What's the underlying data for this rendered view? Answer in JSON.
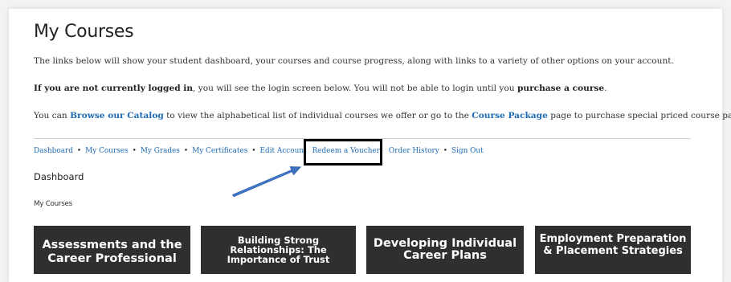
{
  "page": {
    "title": "My Courses"
  },
  "intro": {
    "line1": "The links below will show your student dashboard, your courses and course progress, along with links to a variety of other options on your account.",
    "line2_bold": "If you are not currently logged in",
    "line2_rest": ", you will see the login screen below. You will not be able to login until you ",
    "line2_bold2": "purchase a course",
    "line2_end": ".",
    "line3_a": "You can ",
    "line3_link1": "Browse our Catalog",
    "line3_b": " to view the alphabetical list of individual courses we offer or go to the ",
    "line3_link2": "Course Package",
    "line3_c": " page to purchase special priced course packages."
  },
  "account_nav": {
    "separator": "•",
    "items": [
      "Dashboard",
      "My Courses",
      "My Grades",
      "My Certificates",
      "Edit Account",
      "Redeem a Voucher",
      "Order History",
      "Sign Out"
    ]
  },
  "dashboard": {
    "heading": "Dashboard",
    "subheading": "My Courses"
  },
  "courses": [
    {
      "title": "Assessments and the Career Professional"
    },
    {
      "title": "Building Strong Relationships: The Importance of Trust"
    },
    {
      "title": "Developing Individual Career Plans"
    },
    {
      "title": "Employment Preparation & Placement Strategies"
    }
  ],
  "colors": {
    "link": "#1f6bb5",
    "tile_bg": "#2f2f2f",
    "arrow": "#3f73c4",
    "highlight": "#000000"
  }
}
